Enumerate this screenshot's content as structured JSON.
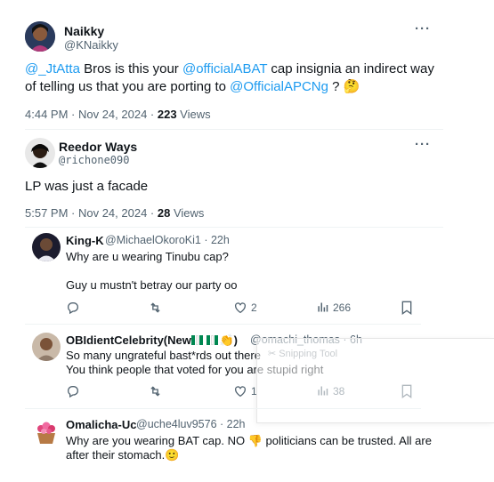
{
  "main_tweet": {
    "name": "Naikky",
    "handle": "@KNaikky",
    "text_mention1": "@_JtAtta",
    "text_part1": " Bros is this your ",
    "text_mention2": "@officialABAT",
    "text_part2": " cap insignia an indirect way of telling us that you are porting to ",
    "text_mention3": "@OfficialAPCNg",
    "text_part3": " ? 🤔",
    "time": "4:44 PM · Nov 24, 2024 · ",
    "views_count": "223",
    "views_label": " Views"
  },
  "reply_main": {
    "name": "Reedor Ways",
    "handle": "@richone090",
    "text": "LP was just a facade",
    "time": "5:57 PM · Nov 24, 2024 · ",
    "views_count": "28",
    "views_label": " Views"
  },
  "replies": [
    {
      "name": "King-K",
      "handle": "@MichaelOkoroKi1 · 22h",
      "line1": "Why are u wearing Tinubu cap?",
      "line2": "Guy u mustn't betray our party oo",
      "likes": "2",
      "views": "266"
    },
    {
      "name": "OBIdientCelebrity(New",
      "name_suffix": ")",
      "handle": "@omachi_thomas · 6h",
      "line1": "So many ungrateful bast*rds out there",
      "line2": "You think people that voted for you are stupid right",
      "likes": "1",
      "views": "38"
    },
    {
      "name": "Omalicha-Uc",
      "handle": "@uche4luv9576 · 22h",
      "line1": "Why are you wearing BAT cap. NO 👎 politicians can be trusted. All are",
      "line2": "after their stomach.🙂"
    }
  ],
  "overlay": {
    "label": "✂ Snipping Tool"
  },
  "icons": [
    "more-icon",
    "reply-icon",
    "retweet-icon",
    "like-icon",
    "views-icon",
    "bookmark-icon"
  ],
  "colors": {
    "link": "#1d9bf0",
    "muted": "#536471",
    "text": "#0f1419",
    "divider": "#eff3f4"
  }
}
